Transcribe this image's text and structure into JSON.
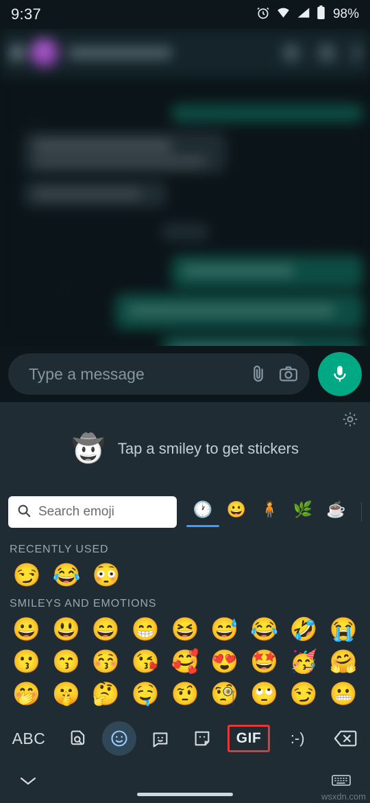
{
  "status_bar": {
    "time": "9:37",
    "battery_percent": "98%",
    "icons": [
      "alarm-icon",
      "wifi-icon",
      "signal-icon",
      "battery-icon"
    ]
  },
  "chat": {
    "header": {
      "avatar": "contact-avatar",
      "icons": [
        "video-call-icon",
        "voice-call-icon",
        "overflow-menu-icon"
      ]
    },
    "content_blurred": true
  },
  "message_input": {
    "placeholder": "Type a message",
    "emoji_icon": "smiley-icon",
    "attach_icon": "paperclip-icon",
    "camera_icon": "camera-icon",
    "mic_icon": "microphone-icon"
  },
  "sticker_strip": {
    "hint_text": "Tap a smiley to get stickers",
    "hint_art": "🤠",
    "settings_icon": "gear-icon"
  },
  "emoji_keyboard": {
    "search": {
      "placeholder": "Search emoji",
      "icon": "search-icon"
    },
    "category_tabs": [
      {
        "name": "recent",
        "glyph": "🕐",
        "active": true
      },
      {
        "name": "smileys",
        "glyph": "😀",
        "active": false
      },
      {
        "name": "people",
        "glyph": "🧍",
        "active": false
      },
      {
        "name": "animals-nature",
        "glyph": "🌿",
        "active": false
      },
      {
        "name": "food-drink",
        "glyph": "☕",
        "active": false
      }
    ],
    "sections": [
      {
        "title": "RECENTLY USED",
        "emojis": [
          "😏",
          "😂",
          "😳"
        ]
      },
      {
        "title": "SMILEYS AND EMOTIONS",
        "rows": [
          [
            "😀",
            "😃",
            "😄",
            "😁",
            "😆",
            "😅",
            "😂",
            "🤣",
            "😭"
          ],
          [
            "😗",
            "😙",
            "😚",
            "😘",
            "🥰",
            "😍",
            "🤩",
            "🥳",
            "🤗"
          ],
          [
            "🤭",
            "🤫",
            "🤔",
            "🤤",
            "🤨",
            "🧐",
            "🙄",
            "😏",
            "😬"
          ]
        ]
      }
    ],
    "bottom_keys": [
      {
        "name": "abc-key",
        "label": "ABC"
      },
      {
        "name": "sticker-search-key",
        "label": "🔍"
      },
      {
        "name": "emoji-key",
        "label": "☺"
      },
      {
        "name": "sticker-key",
        "label": "🙂"
      },
      {
        "name": "avatar-sticker-key",
        "label": "😸"
      },
      {
        "name": "gif-key",
        "label": "GIF",
        "highlighted": true,
        "highlight_color": "#e53935"
      },
      {
        "name": "emoticon-key",
        "label": ":-)"
      },
      {
        "name": "backspace-key",
        "label": "⌫"
      }
    ]
  },
  "nav_bar": {
    "hide_keyboard_icon": "chevron-down-icon",
    "switch_keyboard_icon": "keyboard-icon",
    "gesture_pill": "home-pill"
  },
  "watermark": "wsxdn.com",
  "colors": {
    "accent_teal": "#00a884",
    "tab_blue": "#4d97f7",
    "highlight_red": "#e53935",
    "keyboard_bg": "#1f2c33",
    "chat_bg": "#0b1418"
  }
}
